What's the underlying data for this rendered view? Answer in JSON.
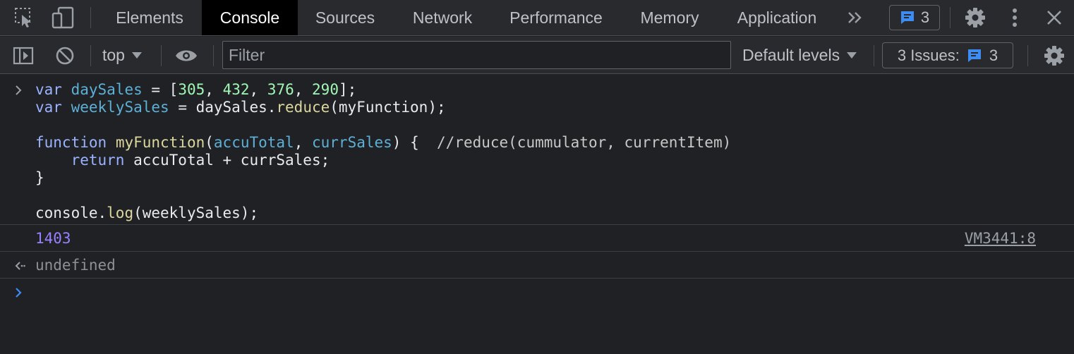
{
  "tabbar": {
    "tabs": [
      {
        "label": "Elements"
      },
      {
        "label": "Console"
      },
      {
        "label": "Sources"
      },
      {
        "label": "Network"
      },
      {
        "label": "Performance"
      },
      {
        "label": "Memory"
      },
      {
        "label": "Application"
      }
    ],
    "active_tab": "Console",
    "issues_badge_count": "3",
    "icons": [
      "inspect-element-icon",
      "device-toolbar-icon",
      "more-tabs-icon",
      "message-icon",
      "settings-icon",
      "kebab-menu-icon",
      "close-icon"
    ]
  },
  "toolbar": {
    "context": "top",
    "filter_placeholder": "Filter",
    "levels": "Default levels",
    "issues_label": "3 Issues:",
    "issues_count": "3",
    "icons": [
      "show-sidebar-icon",
      "clear-console-icon",
      "chevron-down-icon",
      "live-expression-eye-icon",
      "settings-icon"
    ]
  },
  "console": {
    "input_code": [
      "var daySales = [305, 432, 376, 290];",
      "var weeklySales = daySales.reduce(myFunction);",
      "",
      "function myFunction(accuTotal, currSales) {  //reduce(cummulator, currentItem)",
      "    return accuTotal + currSales;",
      "}",
      "",
      "console.log(weeklySales);"
    ],
    "log_output": "1403",
    "log_source": "VM3441:8",
    "return_value": "undefined"
  },
  "colors": {
    "keyword": "#9ab2ff",
    "variable": "#5db0d7",
    "number": "#a1f7b5",
    "function": "#dcd79d",
    "log_number": "#9980ff",
    "active_tab_bg": "#000000",
    "accent_blue": "#3c8cf4"
  }
}
